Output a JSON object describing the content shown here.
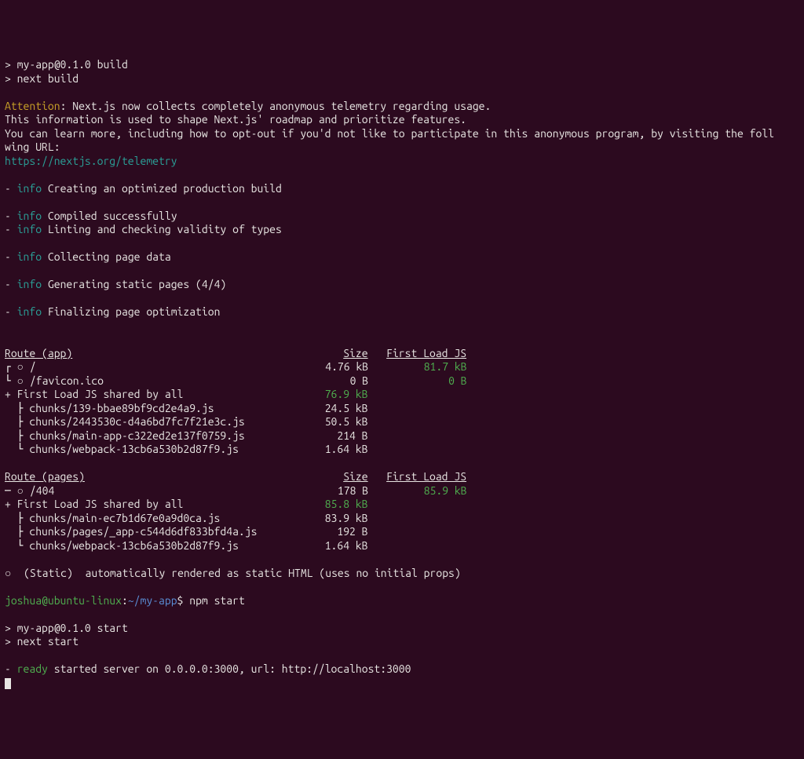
{
  "top": {
    "l1": "> my-app@0.1.0 build",
    "l2": "> next build"
  },
  "telemetry": {
    "attention": "Attention",
    "rest1": ": Next.js now collects completely anonymous telemetry regarding usage.",
    "l2": "This information is used to shape Next.js' roadmap and prioritize features.",
    "l3": "You can learn more, including how to opt-out if you'd not like to participate in this anonymous program, by visiting the foll",
    "l4": "wing URL:",
    "link": "https://nextjs.org/telemetry"
  },
  "info": {
    "dash": "- ",
    "label": "info",
    "s1": " Creating an optimized production build",
    "s2": " Compiled successfully",
    "s3": " Linting and checking validity of types",
    "s4": " Collecting page data",
    "s5": " Generating static pages (4/4)",
    "s6": " Finalizing page optimization"
  },
  "table1": {
    "hRoute": "Route (app)",
    "hSize": "Size",
    "hFL": "First Load JS",
    "rows": [
      {
        "pre": "┌ ○ ",
        "name": "/",
        "size": "4.76 kB",
        "fl": "81.7 kB",
        "flGreen": true
      },
      {
        "pre": "└ ○ ",
        "name": "/favicon.ico",
        "size": "0 B",
        "fl": "0 B",
        "flGreen": true
      },
      {
        "pre": "+ ",
        "name": "First Load JS shared by all",
        "size": "76.9 kB",
        "fl": "",
        "sizeGreen": true
      },
      {
        "pre": "  ├ ",
        "name": "chunks/139-bbae89bf9cd2e4a9.js",
        "size": "24.5 kB",
        "fl": ""
      },
      {
        "pre": "  ├ ",
        "name": "chunks/2443530c-d4a6bd7fc7f21e3c.js",
        "size": "50.5 kB",
        "fl": ""
      },
      {
        "pre": "  ├ ",
        "name": "chunks/main-app-c322ed2e137f0759.js",
        "size": "214 B",
        "fl": ""
      },
      {
        "pre": "  └ ",
        "name": "chunks/webpack-13cb6a530b2d87f9.js",
        "size": "1.64 kB",
        "fl": ""
      }
    ]
  },
  "table2": {
    "hRoute": "Route (pages)",
    "hSize": "Size",
    "hFL": "First Load JS",
    "rows": [
      {
        "pre": "─ ○ ",
        "name": "/404",
        "size": "178 B",
        "fl": "85.9 kB",
        "flGreen": true
      },
      {
        "pre": "+ ",
        "name": "First Load JS shared by all",
        "size": "85.8 kB",
        "fl": "",
        "sizeGreen": true
      },
      {
        "pre": "  ├ ",
        "name": "chunks/main-ec7b1d67e0a9d0ca.js",
        "size": "83.9 kB",
        "fl": ""
      },
      {
        "pre": "  ├ ",
        "name": "chunks/pages/_app-c544d6df833bfd4a.js",
        "size": "192 B",
        "fl": ""
      },
      {
        "pre": "  └ ",
        "name": "chunks/webpack-13cb6a530b2d87f9.js",
        "size": "1.64 kB",
        "fl": ""
      }
    ]
  },
  "legend": "○  (Static)  automatically rendered as static HTML (uses no initial props)",
  "prompt": {
    "user": "joshua@ubuntu-linux",
    "colon": ":",
    "path": "~/my-app",
    "dollar": "$ ",
    "cmd": "npm start"
  },
  "start": {
    "l1": "> my-app@0.1.0 start",
    "l2": "> next start"
  },
  "ready": {
    "dash": "- ",
    "label": "ready",
    "text": " started server on 0.0.0.0:3000, url: http://localhost:3000"
  },
  "cols": {
    "route": 48,
    "size": 11,
    "fl": 13
  }
}
